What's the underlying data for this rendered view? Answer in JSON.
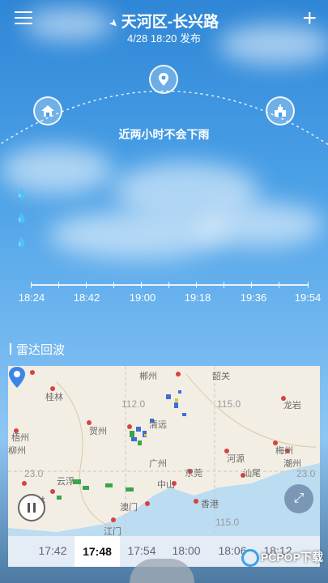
{
  "header": {
    "location": "天河区-长兴路",
    "published": "4/28 18:20 发布"
  },
  "forecast": {
    "message": "近两小时不会下雨"
  },
  "timeline": {
    "labels": [
      "18:24",
      "18:42",
      "19:00",
      "19:18",
      "19:36",
      "19:54"
    ]
  },
  "radar": {
    "title": "雷达回波",
    "grid_labels": [
      "112.0",
      "115.0",
      "23.0",
      "23.0",
      "115.0"
    ],
    "cities": [
      "郴州",
      "桂林",
      "贺州",
      "梧州",
      "清远",
      "韶关",
      "河源",
      "龙岩",
      "梅州",
      "潮州",
      "汕尾",
      "东莞",
      "中山",
      "澳门",
      "香港",
      "江门",
      "云浮",
      "玉林",
      "柳州",
      "广州"
    ],
    "times": [
      "17:42",
      "17:48",
      "17:54",
      "18:00",
      "18:06",
      "18:12"
    ],
    "active_time": "17:48"
  },
  "watermark": "PCPOP下载"
}
